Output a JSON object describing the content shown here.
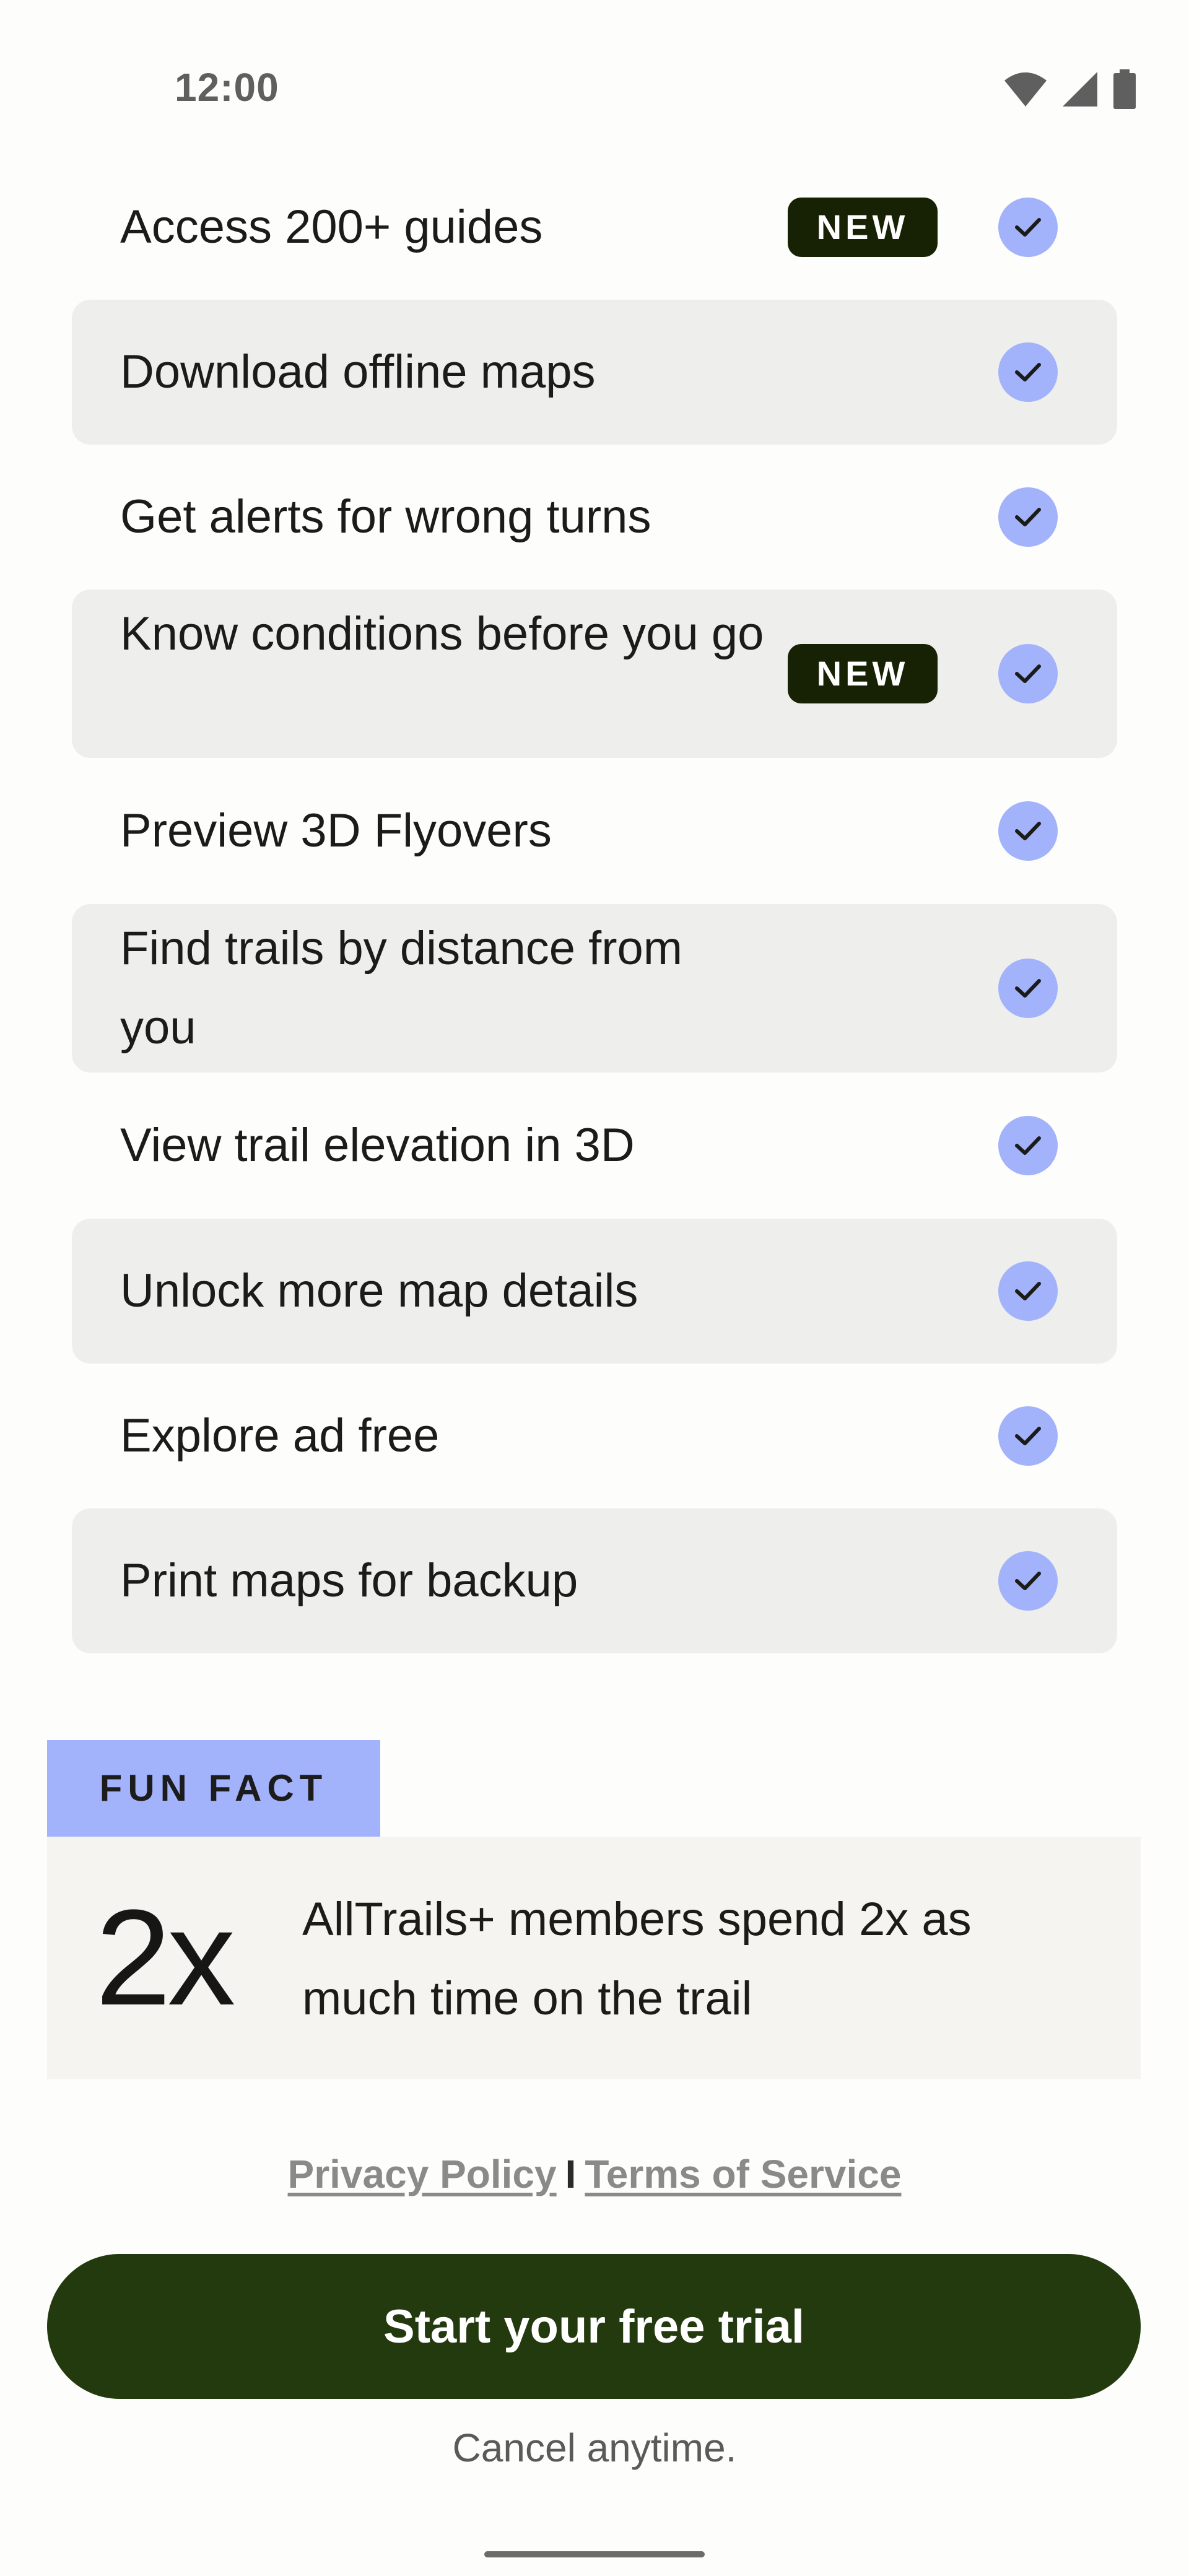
{
  "status_bar": {
    "time": "12:00",
    "icons": [
      "wifi-icon",
      "cellular-signal-icon",
      "battery-icon"
    ]
  },
  "features": [
    {
      "label": "Access 200+ guides",
      "badge": "NEW",
      "checked": true
    },
    {
      "label": "Download offline maps",
      "badge": null,
      "checked": true
    },
    {
      "label": "Get alerts for wrong turns",
      "badge": null,
      "checked": true
    },
    {
      "label": "Know conditions before you go",
      "badge": "NEW",
      "checked": true
    },
    {
      "label": "Preview 3D Flyovers",
      "badge": null,
      "checked": true
    },
    {
      "label": "Find trails by distance from you",
      "badge": null,
      "checked": true
    },
    {
      "label": "View trail elevation in 3D",
      "badge": null,
      "checked": true
    },
    {
      "label": "Unlock more map details",
      "badge": null,
      "checked": true
    },
    {
      "label": "Explore ad free",
      "badge": null,
      "checked": true
    },
    {
      "label": "Print maps for backup",
      "badge": null,
      "checked": true
    }
  ],
  "fun_fact": {
    "tag": "FUN FACT",
    "number": "2x",
    "text": "AllTrails+ members spend 2x as much time on the trail"
  },
  "legal": {
    "privacy": "Privacy Policy",
    "separator": "I",
    "terms": "Terms of Service"
  },
  "cta": {
    "label": "Start your free trial",
    "subtext": "Cancel anytime."
  },
  "colors": {
    "accent": "#a2b2fb",
    "badge_bg": "#172103",
    "cta_bg": "#223a0e",
    "row_shade": "#eeeeed",
    "fun_fact_bg": "#f6f4f0"
  }
}
